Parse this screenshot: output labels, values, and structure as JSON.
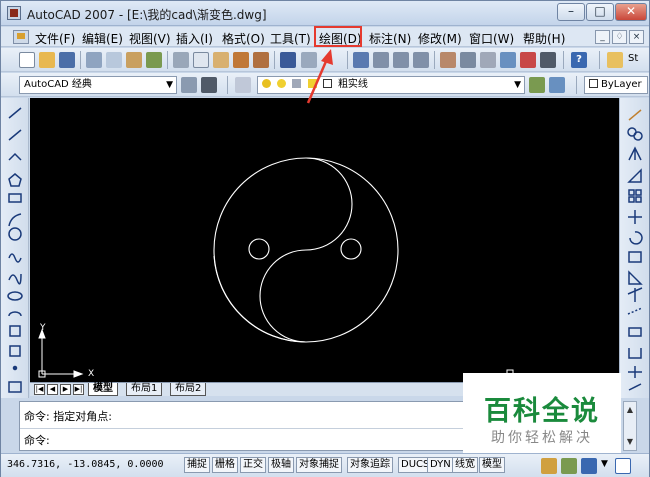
{
  "window": {
    "title": "AutoCAD 2007 - [E:\\我的cad\\渐变色.dwg]",
    "minimize_label": "–",
    "maximize_label": "□",
    "close_label": "✕"
  },
  "menu": {
    "items": [
      {
        "label": "文件(F)"
      },
      {
        "label": "编辑(E)"
      },
      {
        "label": "视图(V)"
      },
      {
        "label": "插入(I)"
      },
      {
        "label": "格式(O)"
      },
      {
        "label": "工具(T)"
      },
      {
        "label": "绘图(D)"
      },
      {
        "label": "标注(N)"
      },
      {
        "label": "修改(M)"
      },
      {
        "label": "窗口(W)"
      },
      {
        "label": "帮助(H)"
      }
    ],
    "highlighted": "绘图(D)",
    "highlight_color": "#e53a2f",
    "mdi_min": "_",
    "mdi_restore": "♢",
    "mdi_close": "×"
  },
  "toolbar": {
    "workspace": "AutoCAD 经典",
    "layer": "粗实线",
    "linetype": "ByLayer",
    "extra_label": "St"
  },
  "canvas": {
    "background": "#000000",
    "ucs_x": "X",
    "ucs_y": "Y"
  },
  "layout_tabs": [
    {
      "label": "模型",
      "active": true
    },
    {
      "label": "布局1",
      "active": false
    },
    {
      "label": "布局2",
      "active": false
    }
  ],
  "command": {
    "line1": "命令: 指定对角点:",
    "line2": "命令:"
  },
  "status": {
    "coords": "346.7316, -13.0845, 0.0000",
    "toggles": [
      "捕捉",
      "栅格",
      "正交",
      "极轴",
      "对象捕捉",
      "对象追踪",
      "DUCS",
      "DYN",
      "线宽",
      "模型"
    ]
  },
  "watermark": {
    "title": "百科全说",
    "subtitle": "助你轻松解决",
    "color": "#1a8a3c"
  }
}
